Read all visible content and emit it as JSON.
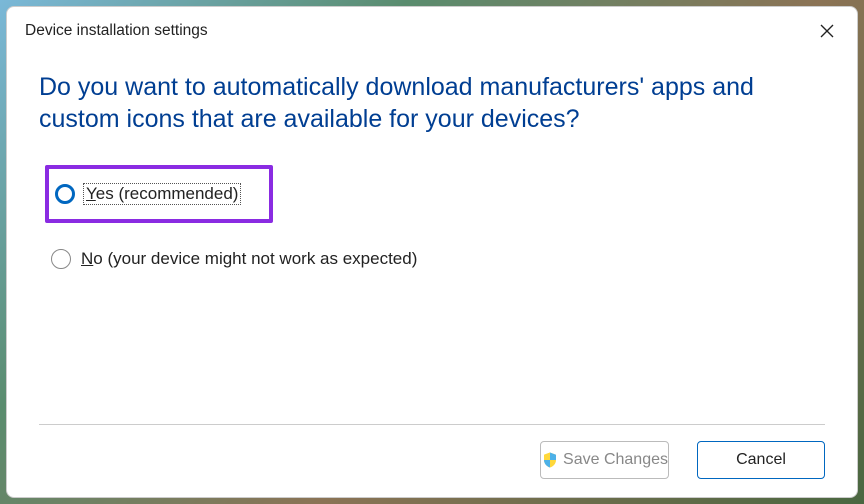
{
  "dialog": {
    "title": "Device installation settings",
    "heading": "Do you want to automatically download manufacturers' apps and custom icons that are available for your devices?",
    "options": {
      "yes": {
        "prefix": "Y",
        "rest": "es (recommended)",
        "selected": true
      },
      "no": {
        "prefix": "N",
        "rest": "o (your device might not work as expected)",
        "selected": false
      }
    },
    "buttons": {
      "save": "Save Changes",
      "cancel": "Cancel"
    }
  }
}
